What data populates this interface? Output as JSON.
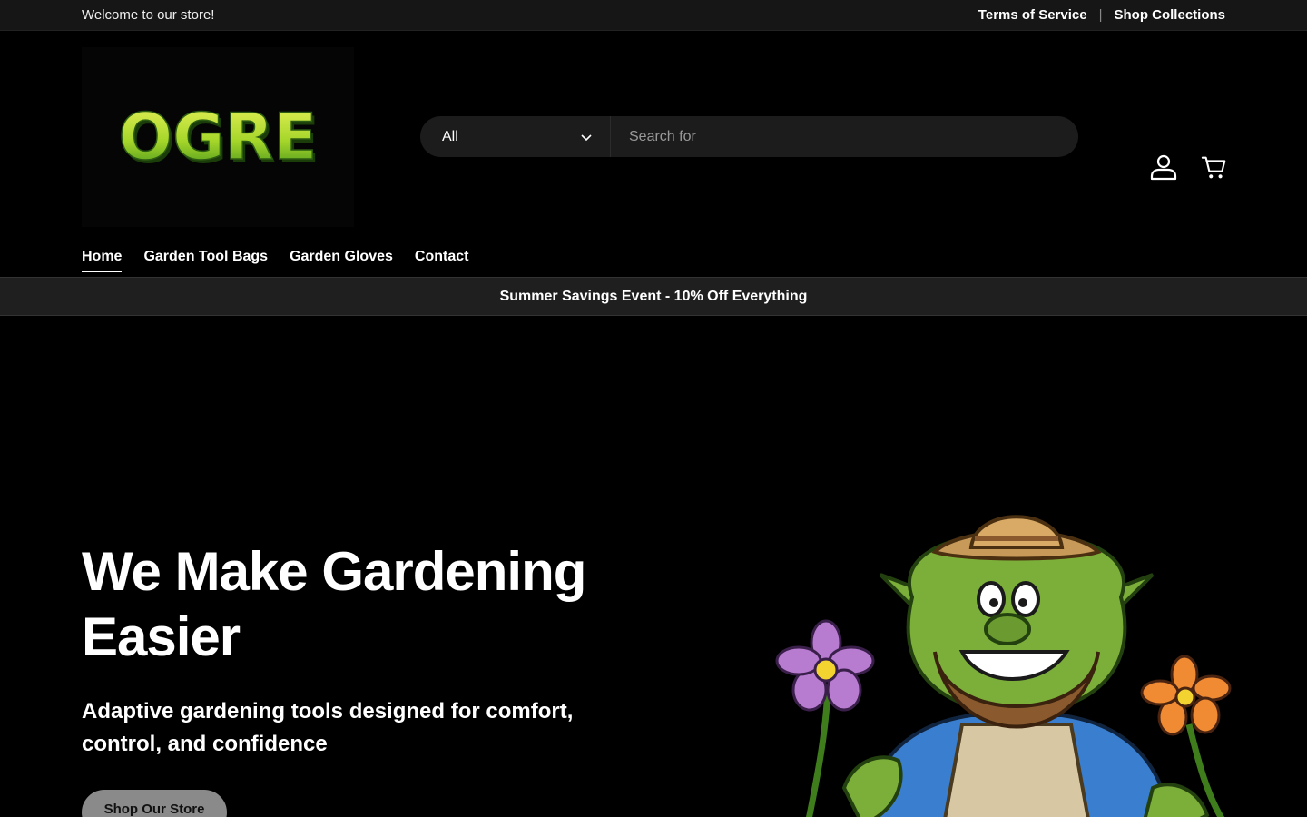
{
  "announcement": {
    "welcome": "Welcome to our store!",
    "links": [
      {
        "label": "Terms of Service"
      },
      {
        "label": "Shop Collections"
      }
    ],
    "separator": "|"
  },
  "header": {
    "logo_text": "OGRE",
    "search": {
      "category": "All",
      "placeholder": "Search for"
    },
    "icons": {
      "account": "account-icon",
      "cart": "cart-icon"
    }
  },
  "nav": {
    "items": [
      {
        "label": "Home",
        "active": true
      },
      {
        "label": "Garden Tool Bags"
      },
      {
        "label": "Garden Gloves"
      },
      {
        "label": "Contact"
      }
    ]
  },
  "promo": {
    "text": "Summer Savings Event - 10% Off Everything"
  },
  "hero": {
    "title": "We Make Gardening Easier",
    "subtitle": "Adaptive gardening tools designed for comfort, control, and confidence",
    "cta": "Shop Our Store"
  },
  "colors": {
    "background": "#000000",
    "top_bar": "#161616",
    "promo_bar": "#1f1f1f",
    "search_bg": "#1c1c1c",
    "button_bg": "#8a8a8a",
    "logo_green": "#a6d62a"
  }
}
